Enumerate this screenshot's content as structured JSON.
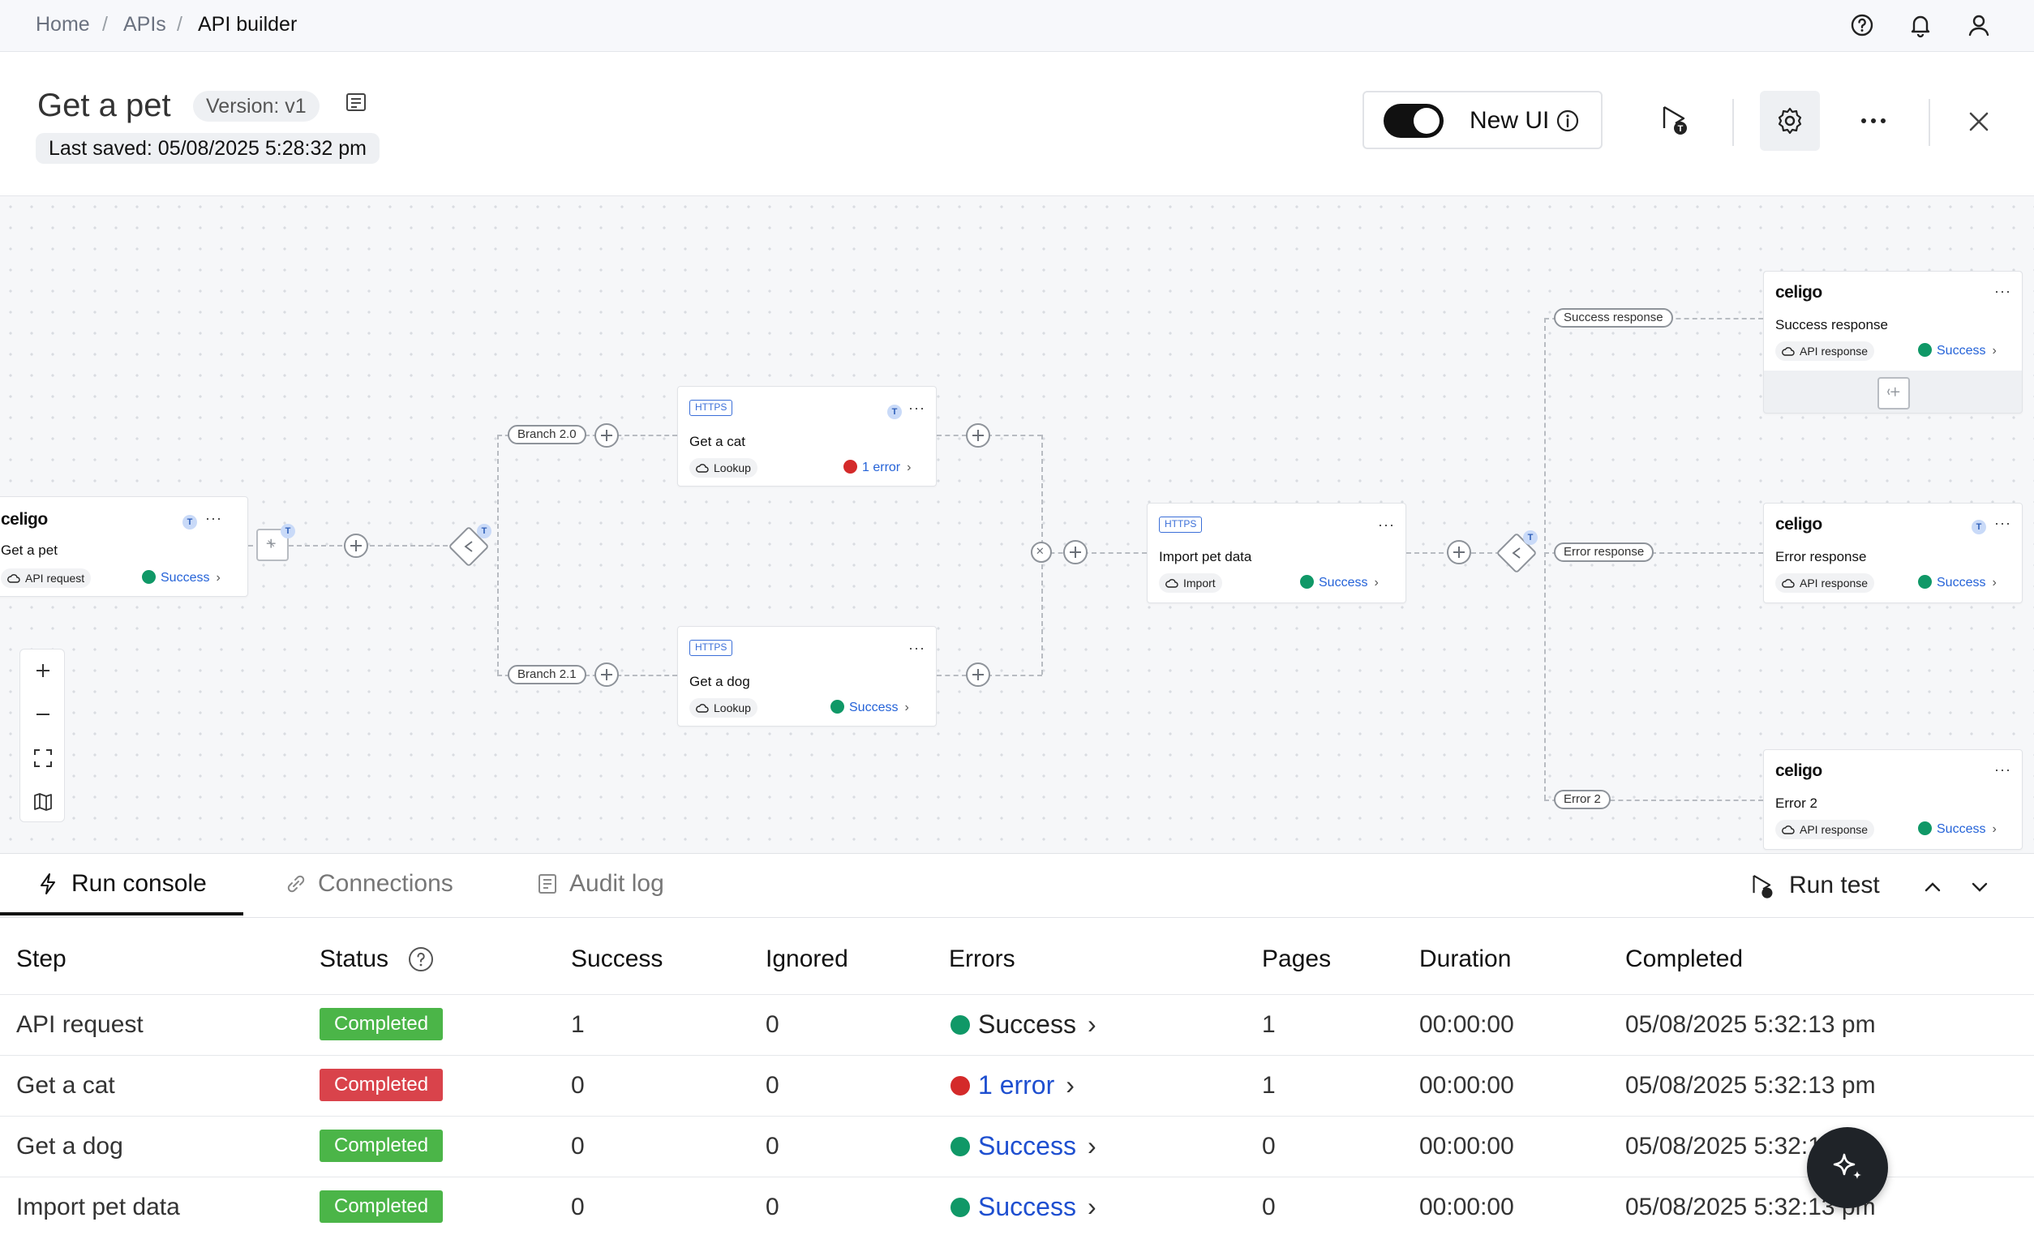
{
  "breadcrumb": {
    "home": "Home",
    "apis": "APIs",
    "current": "API builder",
    "sep": "/"
  },
  "header": {
    "title": "Get a pet",
    "version": "Version: v1",
    "last_saved": "Last saved: 05/08/2025 5:28:32 pm",
    "new_ui_label": "New UI",
    "more": "···"
  },
  "canvas": {
    "branch_labels": [
      "Branch 2.0",
      "Branch 2.1",
      "Success response",
      "Error response",
      "Error 2"
    ],
    "nodes": {
      "source": {
        "logo": "celigo",
        "title": "Get a pet",
        "type": "API request",
        "status": "Success",
        "badge": "T"
      },
      "cat": {
        "tag": "HTTPS",
        "title": "Get a cat",
        "type": "Lookup",
        "status": "1 error",
        "badge": "T"
      },
      "dog": {
        "tag": "HTTPS",
        "title": "Get a dog",
        "type": "Lookup",
        "status": "Success"
      },
      "import": {
        "tag": "HTTPS",
        "title": "Import pet data",
        "type": "Import",
        "status": "Success"
      },
      "success_resp": {
        "logo": "celigo",
        "title": "Success response",
        "type": "API response",
        "status": "Success"
      },
      "error_resp": {
        "logo": "celigo",
        "title": "Error response",
        "type": "API response",
        "status": "Success",
        "badge": "T"
      },
      "error2": {
        "logo": "celigo",
        "title": "Error 2",
        "type": "API response",
        "status": "Success"
      }
    },
    "more": "···",
    "t_badge": "T"
  },
  "tabs": [
    {
      "label": "Run console"
    },
    {
      "label": "Connections"
    },
    {
      "label": "Audit log"
    }
  ],
  "run_test_label": "Run test",
  "table": {
    "headers": [
      "Step",
      "Status",
      "Success",
      "Ignored",
      "Errors",
      "Pages",
      "Duration",
      "Completed"
    ],
    "rows": [
      {
        "step": "API request",
        "status": "Completed",
        "success": "1",
        "ignored": "0",
        "errors": "Success",
        "pages": "1",
        "duration": "00:00:00",
        "completed": "05/08/2025 5:32:13 pm"
      },
      {
        "step": "Get a cat",
        "status": "Completed",
        "success": "0",
        "ignored": "0",
        "errors": "1 error",
        "pages": "1",
        "duration": "00:00:00",
        "completed": "05/08/2025 5:32:13 pm"
      },
      {
        "step": "Get a dog",
        "status": "Completed",
        "success": "0",
        "ignored": "0",
        "errors": "Success",
        "pages": "0",
        "duration": "00:00:00",
        "completed": "05/08/2025 5:32:13 pm"
      },
      {
        "step": "Import pet data",
        "status": "Completed",
        "success": "0",
        "ignored": "0",
        "errors": "Success",
        "pages": "0",
        "duration": "00:00:00",
        "completed": "05/08/2025 5:32:13 pm"
      }
    ]
  },
  "colors": {
    "success_dot": "#109867",
    "error_dot": "#d42a2a",
    "status_green": "#4bb548",
    "status_red": "#d9434b",
    "link_blue": "#1e4fd0"
  }
}
